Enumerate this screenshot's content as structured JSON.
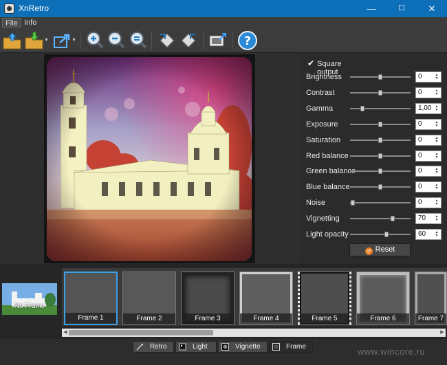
{
  "window": {
    "title": "XnRetro",
    "minimize": "—",
    "maximize": "☐",
    "close": "✕"
  },
  "menu": [
    {
      "label": "File"
    },
    {
      "label": "Info"
    }
  ],
  "settings": {
    "square_output": "Square output",
    "sliders": [
      {
        "label": "Brightness",
        "value": "0",
        "level": 0.5
      },
      {
        "label": "Contrast",
        "value": "0",
        "level": 0.5
      },
      {
        "label": "Gamma",
        "value": "1,00",
        "level": 0.2
      },
      {
        "label": "Exposure",
        "value": "0",
        "level": 0.5
      },
      {
        "label": "Saturation",
        "value": "0",
        "level": 0.5
      },
      {
        "label": "Red balance",
        "value": "0",
        "level": 0.5
      },
      {
        "label": "Green balance",
        "value": "0",
        "level": 0.5
      },
      {
        "label": "Blue balance",
        "value": "0",
        "level": 0.5
      },
      {
        "label": "Noise",
        "value": "0",
        "level": 0.05
      },
      {
        "label": "Vignetting",
        "value": "70",
        "level": 0.7
      },
      {
        "label": "Light opacity",
        "value": "60",
        "level": 0.6
      }
    ],
    "reset": "Reset"
  },
  "frames": {
    "no_frame": "No Frame",
    "items": [
      {
        "label": "Frame 1"
      },
      {
        "label": "Frame 2"
      },
      {
        "label": "Frame 3"
      },
      {
        "label": "Frame 4"
      },
      {
        "label": "Frame 5"
      },
      {
        "label": "Frame 6"
      },
      {
        "label": "Frame 7"
      }
    ]
  },
  "tabs": [
    {
      "label": "Retro"
    },
    {
      "label": "Light"
    },
    {
      "label": "Vignette"
    },
    {
      "label": "Frame"
    }
  ],
  "watermark": "www.wincore.ru",
  "colors": {
    "titlebar": "#0d6fb8",
    "selection": "#3a9fe8",
    "accent": "#e67e22"
  }
}
